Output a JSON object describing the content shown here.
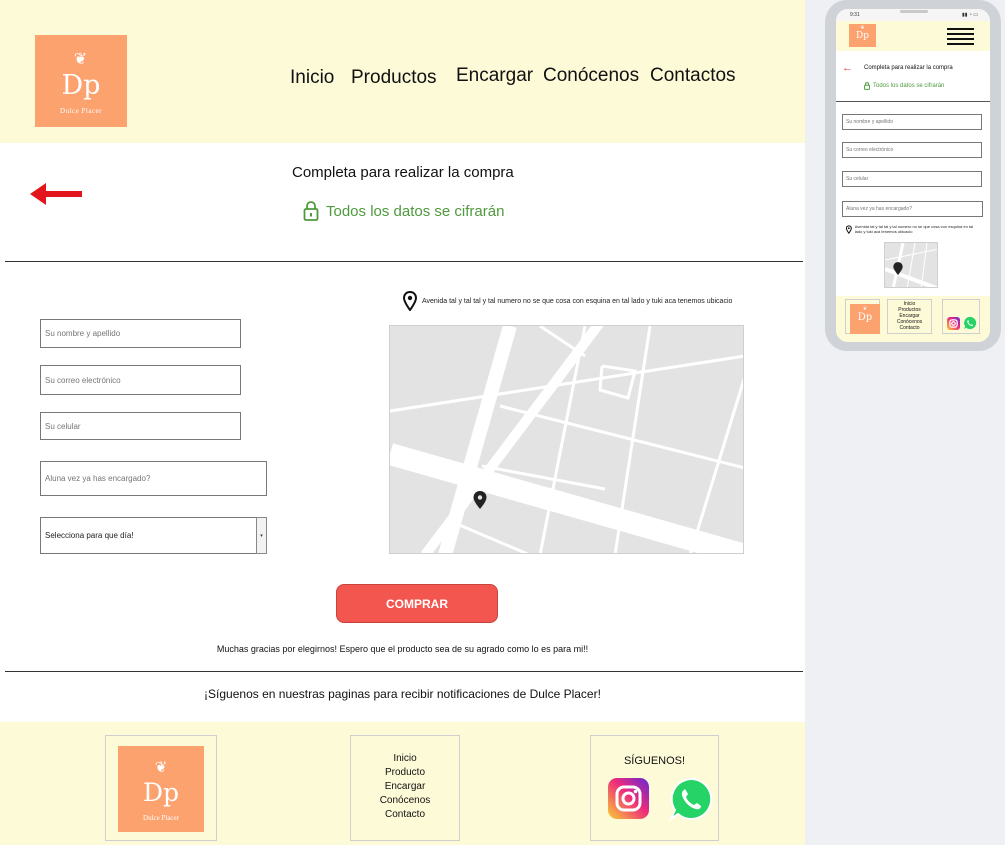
{
  "brand": {
    "monogram": "Dp",
    "name": "Dulce Placer",
    "ornament": "❦",
    "color": "#fca26e"
  },
  "nav": [
    "Inicio",
    "Productos",
    "Encargar",
    "Conócenos",
    "Contactos"
  ],
  "checkout": {
    "title": "Completa para realizar la compra",
    "secure_text": "Todos los datos se cifrarán",
    "fields": {
      "name_placeholder": "Su nombre y apellido",
      "email_placeholder": "Su correo electrónico",
      "phone_placeholder": "Su celular",
      "ordered_placeholder": "Aluna vez ya has encargado?",
      "day_select_value": "Selecciona para que día!"
    },
    "address": "Avenida tal y tal tal y tal numero no se que cosa con esquina en tal lado y tuki aca tenemos ubicacio",
    "buy_label": "COMPRAR",
    "thanks": "Muchas gracias por elegirnos! Espero que el producto sea de su agrado como lo es para mi!!"
  },
  "follow_text": "¡Síguenos en nuestras paginas para recibir notificaciones de Dulce Placer!",
  "footer": {
    "links": [
      "Inicio",
      "Producto",
      "Encargar",
      "Conócenos",
      "Contacto"
    ],
    "follow_title": "SÍGUENOS!",
    "social_icons": [
      "instagram-icon",
      "whatsapp-icon"
    ]
  },
  "mobile": {
    "status_time": "9:31",
    "title": "Completa para realizar la compra",
    "secure_text": "Todos los datos se cifrarán",
    "fields": {
      "name_placeholder": "Su nombre y apellido",
      "email_placeholder": "Su correo electrónico",
      "phone_placeholder": "Su celular",
      "ordered_placeholder": "Aluna vez ya has encargado?"
    },
    "address": "Avenida tal y tal tal y tal numero no se que cosa con esquina en tal lado y tuki aca tenemos ubicacio",
    "footer_links": [
      "Inicio",
      "Productos",
      "Encargar",
      "Conócenos",
      "Contacto"
    ]
  },
  "colors": {
    "header_bg": "#fdfad8",
    "accent_red": "#f3564e",
    "secure_green": "#4f9a3d",
    "arrow_red": "#e3141b"
  }
}
